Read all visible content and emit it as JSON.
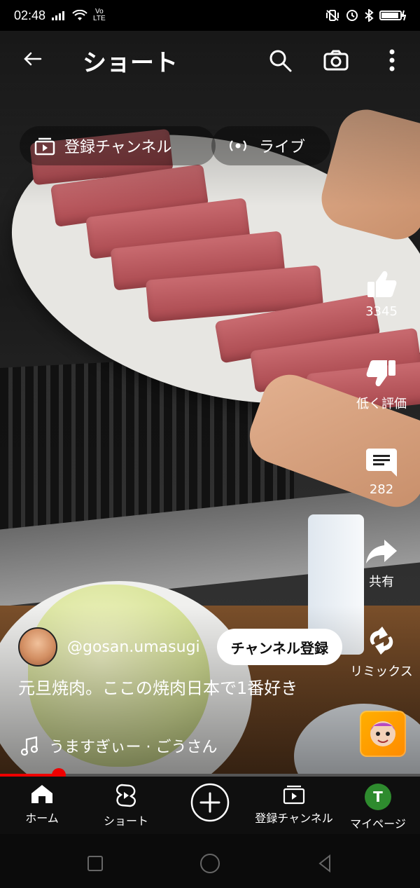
{
  "status": {
    "time": "02:48",
    "network_top": "Vo",
    "network_bottom": "LTE"
  },
  "topbar": {
    "title": "ショート",
    "icons": [
      "back-arrow-icon",
      "search-icon",
      "camera-icon",
      "more-vert-icon"
    ]
  },
  "chips": {
    "subscriptions": "登録チャンネル",
    "live": "ライブ"
  },
  "actions": {
    "like_count": "3345",
    "dislike_label": "低く評価",
    "comment_count": "282",
    "share_label": "共有",
    "remix_label": "リミックス"
  },
  "video": {
    "channel_handle": "@gosan.umasugi",
    "subscribe_label": "チャンネル登録",
    "caption": "元旦焼肉。ここの焼肉日本で1番好き",
    "music": "うますぎぃー · ごうさん",
    "progress_ratio": 0.14
  },
  "bottom_nav": {
    "items": [
      {
        "label": "ホーム",
        "icon": "home-icon"
      },
      {
        "label": "ショート",
        "icon": "shorts-icon"
      },
      {
        "label": "",
        "icon": "add-icon"
      },
      {
        "label": "登録チャンネル",
        "icon": "subscriptions-icon"
      },
      {
        "label": "マイページ",
        "icon": "avatar-icon"
      }
    ],
    "avatar_letter": "T"
  },
  "colors": {
    "accent_red": "#ff0000",
    "avatar_green": "#2e8b2e"
  }
}
